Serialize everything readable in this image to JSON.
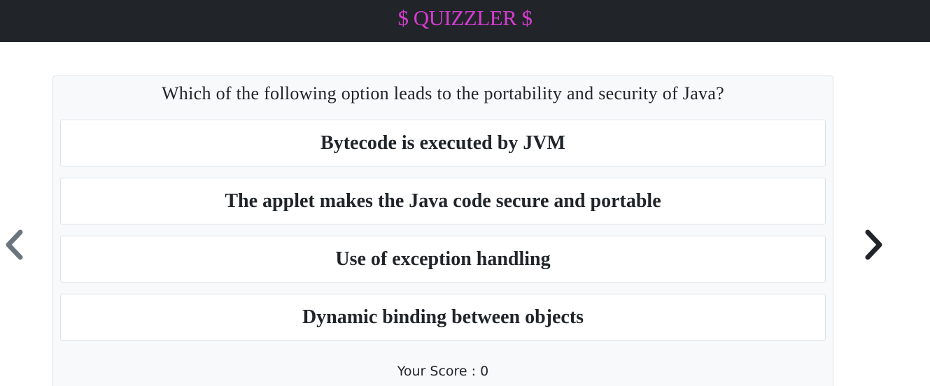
{
  "header": {
    "title": "$ QUIZZLER $"
  },
  "quiz": {
    "question": "Which of the following option leads to the portability and security of Java?",
    "options": [
      "Bytecode is executed by JVM",
      "The applet makes the Java code secure and portable",
      "Use of exception handling",
      "Dynamic binding between objects"
    ],
    "score_text": "Your Score : 0"
  },
  "navigation": {
    "prev_icon": "chevron-left-icon",
    "next_icon": "chevron-right-icon"
  },
  "colors": {
    "header_bg": "#212529",
    "brand": "#d63bd1",
    "card_bg": "#f8f9fa",
    "prev_arrow": "#6c757d",
    "next_arrow": "#212529"
  }
}
